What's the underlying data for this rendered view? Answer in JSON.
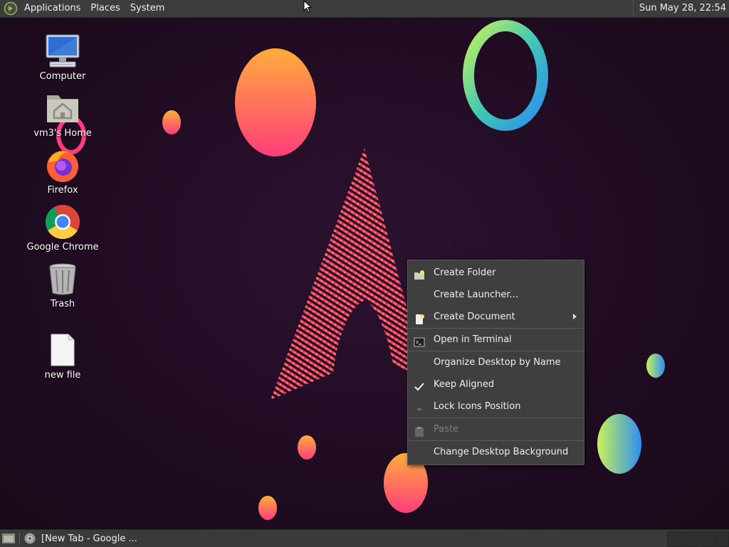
{
  "top_panel": {
    "menus": [
      "Applications",
      "Places",
      "System"
    ],
    "clock": "Sun May 28, 22:54"
  },
  "desktop_icons": [
    {
      "label": "Computer",
      "icon": "computer-icon"
    },
    {
      "label": "vm3's Home",
      "icon": "home-folder-icon"
    },
    {
      "label": "Firefox",
      "icon": "firefox-icon"
    },
    {
      "label": "Google Chrome",
      "icon": "chrome-icon"
    },
    {
      "label": "Trash",
      "icon": "trash-icon"
    },
    {
      "label": "new file",
      "icon": "file-icon"
    }
  ],
  "context_menu": {
    "items": [
      {
        "label": "Create Folder",
        "icon": "folder-new-icon"
      },
      {
        "label": "Create Launcher...",
        "icon": ""
      },
      {
        "label": "Create Document",
        "icon": "document-new-icon",
        "submenu": true
      },
      {
        "label": "Open in Terminal",
        "icon": "terminal-icon"
      },
      {
        "label": "Organize Desktop by Name",
        "icon": ""
      },
      {
        "label": "Keep Aligned",
        "icon": "checkmark-icon",
        "checked": true
      },
      {
        "label": "Lock Icons Position",
        "icon": "checkbox-unchecked-icon"
      },
      {
        "label": "Paste",
        "icon": "paste-icon",
        "disabled": true
      },
      {
        "label": "Change Desktop Background",
        "icon": ""
      }
    ]
  },
  "taskbar": {
    "window_title": "[New Tab - Google ..."
  },
  "colors": {
    "panel_bg": "#3c3c3c",
    "menu_bg": "#3f3f3f",
    "desktop_bg": "#210c23",
    "text": "#eeeeee",
    "disabled_text": "#7d7d7d"
  }
}
